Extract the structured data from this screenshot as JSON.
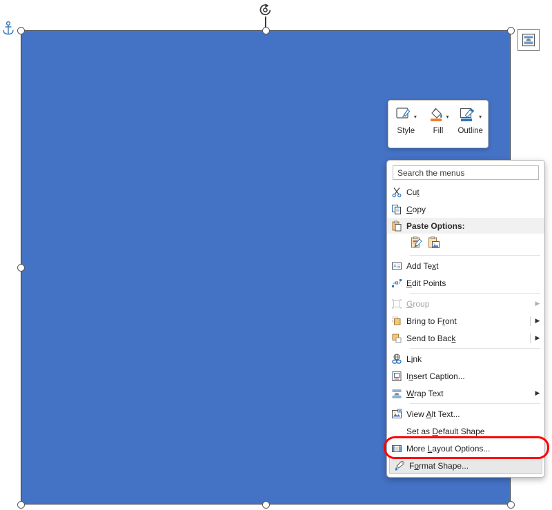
{
  "app": {
    "name": "Word Shape Context Menu",
    "accent_blue": "#4472C4",
    "shape_outline": "#2F3B4C",
    "annotation_color": "#FF0000",
    "menu_highlight": "#E8E8E8"
  },
  "canvas": {
    "shape": {
      "name": "Rectangle",
      "fill_color": "#4472C4",
      "outline_color": "#2F3B4C",
      "selected": true
    },
    "rotate_handle": "rotate-icon",
    "anchor": "anchor-icon",
    "handles": [
      "top-left",
      "top-center",
      "top-right",
      "middle-left",
      "middle-right",
      "bottom-left",
      "bottom-center",
      "bottom-right"
    ]
  },
  "layout_options": {
    "icon": "layout-options-icon",
    "tooltip": "Layout Options"
  },
  "mini_toolbar": {
    "items": [
      {
        "label": "Style",
        "icon": "shape-style-icon",
        "has_dropdown": true
      },
      {
        "label": "Fill",
        "icon": "shape-fill-icon",
        "has_dropdown": true
      },
      {
        "label": "Outline",
        "icon": "shape-outline-icon",
        "has_dropdown": true
      }
    ]
  },
  "context_menu": {
    "search": {
      "placeholder": "Search the menus",
      "value": "",
      "label": "Search the menus"
    },
    "items": [
      {
        "label": "Cut",
        "accel": "t",
        "icon": "cut-icon",
        "type": "item",
        "submenu": false,
        "disabled": false
      },
      {
        "label": "Copy",
        "accel": "C",
        "icon": "copy-icon",
        "type": "item",
        "submenu": false,
        "disabled": false
      },
      {
        "label": "Paste Options:",
        "accel": "",
        "icon": "paste-icon",
        "type": "header",
        "submenu": false,
        "disabled": false
      },
      {
        "label": "",
        "accel": "",
        "icon": "paste-option-row",
        "type": "icons",
        "submenu": false,
        "disabled": false
      },
      {
        "label": "Add Text",
        "accel": "x",
        "icon": "add-text-icon",
        "type": "item",
        "submenu": false,
        "disabled": false
      },
      {
        "label": "Edit Points",
        "accel": "E",
        "icon": "edit-points-icon",
        "type": "item",
        "submenu": false,
        "disabled": false
      },
      {
        "label": "Group",
        "accel": "G",
        "icon": "group-icon",
        "type": "item",
        "submenu": true,
        "disabled": true
      },
      {
        "label": "Bring to Front",
        "accel": "r",
        "icon": "bring-front-icon",
        "type": "item",
        "submenu": true,
        "disabled": false
      },
      {
        "label": "Send to Back",
        "accel": "k",
        "icon": "send-back-icon",
        "type": "item",
        "submenu": true,
        "disabled": false
      },
      {
        "label": "Link",
        "accel": "i",
        "icon": "link-icon",
        "type": "item",
        "submenu": false,
        "disabled": false
      },
      {
        "label": "Insert Caption...",
        "accel": "n",
        "icon": "insert-caption-icon",
        "type": "item",
        "submenu": false,
        "disabled": false
      },
      {
        "label": "Wrap Text",
        "accel": "W",
        "icon": "wrap-text-icon",
        "type": "item",
        "submenu": true,
        "disabled": false
      },
      {
        "label": "View Alt Text...",
        "accel": "A",
        "icon": "alt-text-icon",
        "type": "item",
        "submenu": false,
        "disabled": false
      },
      {
        "label": "Set as Default Shape",
        "accel": "D",
        "icon": "none",
        "type": "item",
        "submenu": false,
        "disabled": false
      },
      {
        "label": "More Layout Options...",
        "accel": "L",
        "icon": "more-layout-icon",
        "type": "item",
        "submenu": false,
        "disabled": false
      },
      {
        "label": "Format Shape...",
        "accel": "o",
        "icon": "format-shape-icon",
        "type": "item",
        "submenu": false,
        "disabled": false,
        "highlighted": true,
        "annotated": true
      }
    ],
    "paste_options": [
      {
        "name": "keep-source-formatting",
        "tooltip": "Keep Source Formatting"
      },
      {
        "name": "picture",
        "tooltip": "Picture"
      }
    ]
  },
  "labels": {
    "cut": "Cut",
    "copy": "Copy",
    "paste_options": "Paste Options:",
    "add_text": "Add Text",
    "edit_points": "Edit Points",
    "group": "Group",
    "bring_to_front": "Bring to Front",
    "send_to_back": "Send to Back",
    "link": "Link",
    "insert_caption": "Insert Caption...",
    "wrap_text": "Wrap Text",
    "view_alt_text": "View Alt Text...",
    "set_as_default_shape": "Set as Default Shape",
    "more_layout_options": "More Layout Options...",
    "format_shape": "Format Shape...",
    "style": "Style",
    "fill": "Fill",
    "outline": "Outline",
    "search_menus": "Search the menus"
  }
}
